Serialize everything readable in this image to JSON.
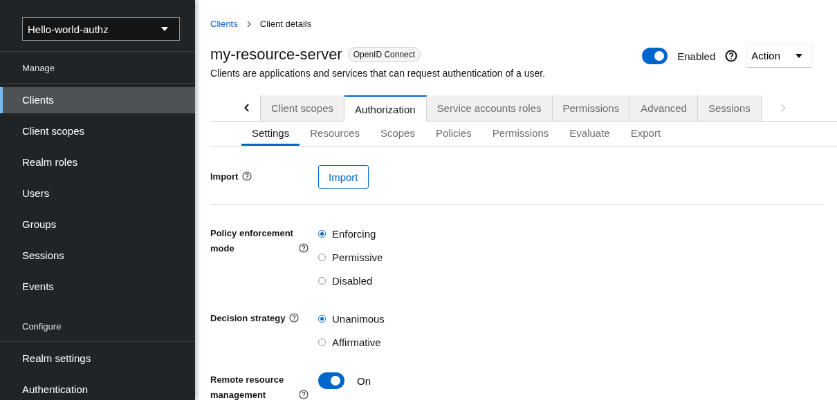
{
  "sidebar": {
    "realm_selector": "Hello-world-authz",
    "sections": [
      {
        "heading": "Manage",
        "items": [
          {
            "label": "Clients",
            "selected": true
          },
          {
            "label": "Client scopes",
            "selected": false
          },
          {
            "label": "Realm roles",
            "selected": false
          },
          {
            "label": "Users",
            "selected": false
          },
          {
            "label": "Groups",
            "selected": false
          },
          {
            "label": "Sessions",
            "selected": false
          },
          {
            "label": "Events",
            "selected": false
          }
        ]
      },
      {
        "heading": "Configure",
        "items": [
          {
            "label": "Realm settings",
            "selected": false
          },
          {
            "label": "Authentication",
            "selected": false
          }
        ]
      }
    ]
  },
  "breadcrumb": [
    {
      "label": "Clients",
      "kind": "link"
    },
    {
      "label": "Client details",
      "kind": "current"
    }
  ],
  "header": {
    "title": "my-resource-server",
    "badge": "OpenID Connect",
    "description": "Clients are applications and services that can request authentication of a user.",
    "enabled": {
      "label": "Enabled",
      "on": true
    },
    "action": "Action"
  },
  "tabs": [
    {
      "label": "Client scopes",
      "selected": false
    },
    {
      "label": "Authorization",
      "selected": true
    },
    {
      "label": "Service accounts roles",
      "selected": false
    },
    {
      "label": "Permissions",
      "selected": false
    },
    {
      "label": "Advanced",
      "selected": false
    },
    {
      "label": "Sessions",
      "selected": false
    }
  ],
  "subtabs": [
    {
      "label": "Settings",
      "selected": true
    },
    {
      "label": "Resources",
      "selected": false
    },
    {
      "label": "Scopes",
      "selected": false
    },
    {
      "label": "Policies",
      "selected": false
    },
    {
      "label": "Permissions",
      "selected": false
    },
    {
      "label": "Evaluate",
      "selected": false
    },
    {
      "label": "Export",
      "selected": false
    }
  ],
  "form": [
    {
      "kind": "button",
      "label": "Import",
      "button": "Import"
    },
    {
      "kind": "radio",
      "label": "Policy enforcement mode",
      "options": [
        {
          "label": "Enforcing",
          "selected": true
        },
        {
          "label": "Permissive",
          "selected": false
        },
        {
          "label": "Disabled",
          "selected": false
        }
      ]
    },
    {
      "kind": "radio",
      "label": "Decision strategy",
      "options": [
        {
          "label": "Unanimous",
          "selected": true
        },
        {
          "label": "Affirmative",
          "selected": false
        }
      ]
    },
    {
      "kind": "switch",
      "label": "Remote resource management",
      "on": true,
      "value": "On"
    }
  ]
}
